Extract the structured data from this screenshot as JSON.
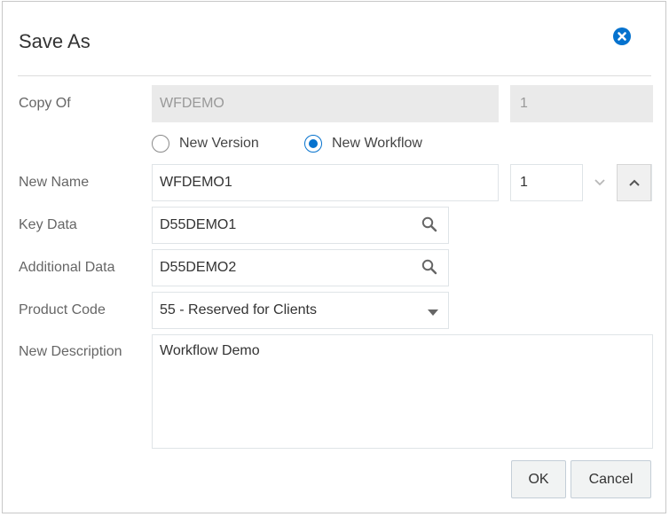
{
  "dialog": {
    "title": "Save As"
  },
  "form": {
    "copy_of": {
      "label": "Copy Of",
      "value": "WFDEMO",
      "version": "1"
    },
    "radios": [
      {
        "label": "New Version",
        "checked": false
      },
      {
        "label": "New Workflow",
        "checked": true
      }
    ],
    "new_name": {
      "label": "New Name",
      "value": "WFDEMO1",
      "version": "1"
    },
    "key_data": {
      "label": "Key Data",
      "value": "D55DEMO1"
    },
    "additional_data": {
      "label": "Additional Data",
      "value": "D55DEMO2"
    },
    "product_code": {
      "label": "Product Code",
      "value": "55 - Reserved for Clients"
    },
    "new_description": {
      "label": "New Description",
      "value": "Workflow Demo"
    }
  },
  "buttons": {
    "ok": "OK",
    "cancel": "Cancel"
  },
  "icons": {
    "close": "close-icon",
    "search": "search-icon",
    "chevron_down": "chevron-down-icon",
    "chevron_up": "chevron-up-icon",
    "dropdown": "dropdown-arrow-icon"
  },
  "colors": {
    "accent": "#0572ce",
    "disabled_bg": "#eaeaea",
    "label": "#666666"
  }
}
